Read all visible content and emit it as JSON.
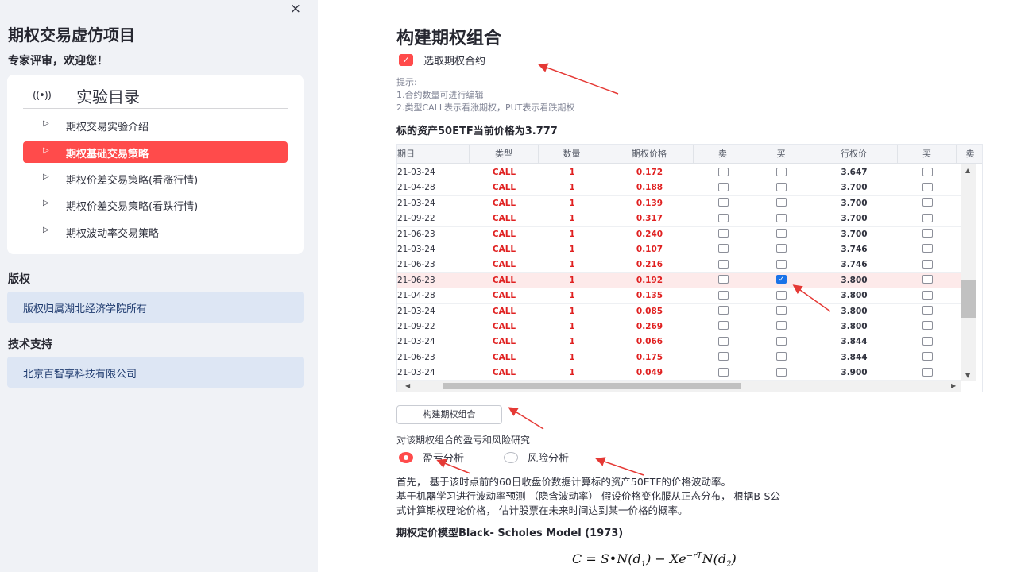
{
  "sidebar": {
    "close_icon": "×",
    "app_title": "期权交易虚仿项目",
    "welcome": "专家评审，欢迎您！",
    "menu": {
      "icon": "((•))",
      "title": "实验目录",
      "items": [
        {
          "label": "期权交易实验介绍",
          "active": false
        },
        {
          "label": "期权基础交易策略",
          "active": true
        },
        {
          "label": "期权价差交易策略(看涨行情)",
          "active": false
        },
        {
          "label": "期权价差交易策略(看跌行情)",
          "active": false
        },
        {
          "label": "期权波动率交易策略",
          "active": false
        }
      ]
    },
    "copyright_title": "版权",
    "copyright_text": "版权归属湖北经济学院所有",
    "support_title": "技术支持",
    "support_text": "北京百智享科技有限公司"
  },
  "main": {
    "title": "构建期权组合",
    "select_checkbox_label": "选取期权合约",
    "hint_lines": [
      "提示:",
      "1.合约数量可进行编辑",
      "2.类型CALL表示看涨期权，PUT表示看跌期权"
    ],
    "price_line": "标的资产50ETF当前价格为3.777",
    "table": {
      "headers": [
        "期日",
        "类型",
        "数量",
        "期权价格",
        "卖",
        "买",
        "行权价",
        "买",
        "卖"
      ],
      "rows": [
        {
          "date": "21-03-24",
          "type": "CALL",
          "qty": "1",
          "price": "0.172",
          "sell": false,
          "buy": false,
          "strike": "3.647",
          "buy2": false
        },
        {
          "date": "21-04-28",
          "type": "CALL",
          "qty": "1",
          "price": "0.188",
          "sell": false,
          "buy": false,
          "strike": "3.700",
          "buy2": false
        },
        {
          "date": "21-03-24",
          "type": "CALL",
          "qty": "1",
          "price": "0.139",
          "sell": false,
          "buy": false,
          "strike": "3.700",
          "buy2": false
        },
        {
          "date": "21-09-22",
          "type": "CALL",
          "qty": "1",
          "price": "0.317",
          "sell": false,
          "buy": false,
          "strike": "3.700",
          "buy2": false
        },
        {
          "date": "21-06-23",
          "type": "CALL",
          "qty": "1",
          "price": "0.240",
          "sell": false,
          "buy": false,
          "strike": "3.700",
          "buy2": false
        },
        {
          "date": "21-03-24",
          "type": "CALL",
          "qty": "1",
          "price": "0.107",
          "sell": false,
          "buy": false,
          "strike": "3.746",
          "buy2": false
        },
        {
          "date": "21-06-23",
          "type": "CALL",
          "qty": "1",
          "price": "0.216",
          "sell": false,
          "buy": false,
          "strike": "3.746",
          "buy2": false
        },
        {
          "date": "21-06-23",
          "type": "CALL",
          "qty": "1",
          "price": "0.192",
          "sell": false,
          "buy": true,
          "strike": "3.800",
          "buy2": false,
          "highlight": true
        },
        {
          "date": "21-04-28",
          "type": "CALL",
          "qty": "1",
          "price": "0.135",
          "sell": false,
          "buy": false,
          "strike": "3.800",
          "buy2": false
        },
        {
          "date": "21-03-24",
          "type": "CALL",
          "qty": "1",
          "price": "0.085",
          "sell": false,
          "buy": false,
          "strike": "3.800",
          "buy2": false
        },
        {
          "date": "21-09-22",
          "type": "CALL",
          "qty": "1",
          "price": "0.269",
          "sell": false,
          "buy": false,
          "strike": "3.800",
          "buy2": false
        },
        {
          "date": "21-03-24",
          "type": "CALL",
          "qty": "1",
          "price": "0.066",
          "sell": false,
          "buy": false,
          "strike": "3.844",
          "buy2": false
        },
        {
          "date": "21-06-23",
          "type": "CALL",
          "qty": "1",
          "price": "0.175",
          "sell": false,
          "buy": false,
          "strike": "3.844",
          "buy2": false
        },
        {
          "date": "21-03-24",
          "type": "CALL",
          "qty": "1",
          "price": "0.049",
          "sell": false,
          "buy": false,
          "strike": "3.900",
          "buy2": false
        }
      ]
    },
    "build_button": "构建期权组合",
    "radio_caption": "对该期权组合的盈亏和风险研究",
    "radio_options": [
      {
        "label": "盈亏分析",
        "selected": true
      },
      {
        "label": "风险分析",
        "selected": false
      }
    ],
    "paragraphs": [
      "首先， 基于该时点前的60日收盘价数据计算标的资产50ETF的价格波动率。",
      "基于机器学习进行波动率预测 （隐含波动率） 假设价格变化服从正态分布， 根据B-S公",
      "式计算期权理论价格， 估计股票在未来时间达到某一价格的概率。"
    ],
    "model_title": "期权定价模型Black- Scholes Model (1973)",
    "formula": {
      "lhs": "C = S•N(d",
      "d1": "1",
      "mid": ") − Xe",
      "exp": "−rT",
      "rhs": "N(d",
      "d2": "2",
      "end": ")"
    }
  },
  "colors": {
    "accent": "#ff4b4b",
    "sidebar_bg": "#f0f2f6",
    "info_bg": "#dde6f4",
    "call_red": "#e02020",
    "checkbox_blue": "#1a73e8"
  }
}
